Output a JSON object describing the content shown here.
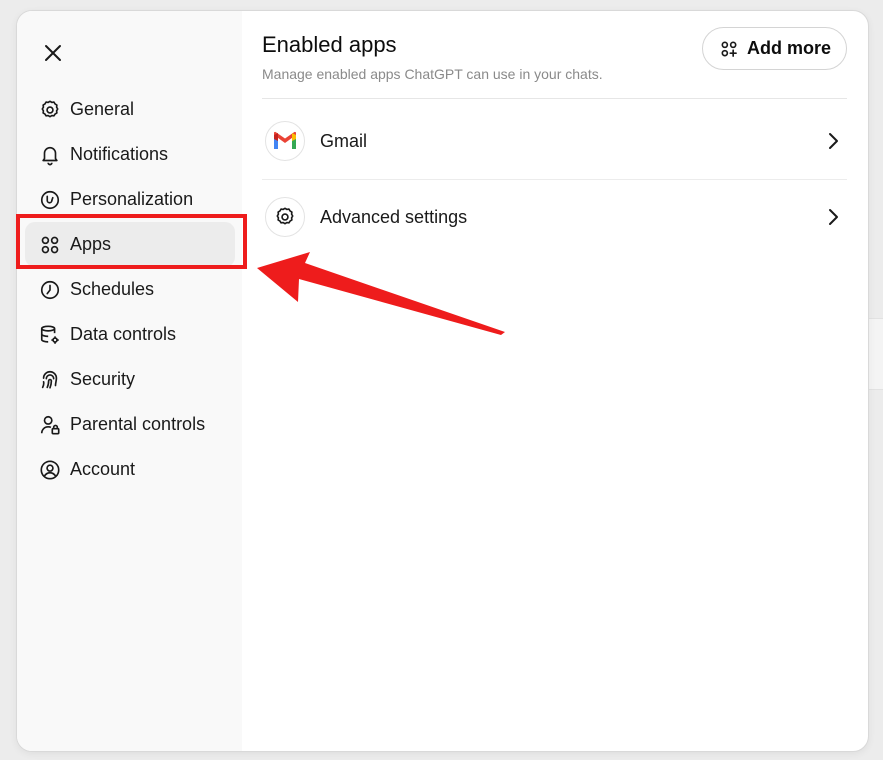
{
  "sidebar": {
    "close_label": "Close",
    "items": [
      {
        "label": "General",
        "icon": "gear-icon",
        "active": false
      },
      {
        "label": "Notifications",
        "icon": "bell-icon",
        "active": false
      },
      {
        "label": "Personalization",
        "icon": "personalization-icon",
        "active": false
      },
      {
        "label": "Apps",
        "icon": "apps-grid-icon",
        "active": true
      },
      {
        "label": "Schedules",
        "icon": "clock-icon",
        "active": false
      },
      {
        "label": "Data controls",
        "icon": "database-gear-icon",
        "active": false
      },
      {
        "label": "Security",
        "icon": "fingerprint-icon",
        "active": false
      },
      {
        "label": "Parental controls",
        "icon": "person-lock-icon",
        "active": false
      },
      {
        "label": "Account",
        "icon": "user-circle-icon",
        "active": false
      }
    ]
  },
  "main": {
    "title": "Enabled apps",
    "subtitle": "Manage enabled apps ChatGPT can use in your chats.",
    "add_more_label": "Add more",
    "rows": [
      {
        "label": "Gmail",
        "icon": "gmail-icon"
      },
      {
        "label": "Advanced settings",
        "icon": "gear-icon"
      }
    ]
  },
  "annotations": {
    "highlight_color": "#ee1c1c",
    "highlight_target": "Apps",
    "arrow_color": "#ee1c1c"
  },
  "colors": {
    "sidebar_bg": "#f9f9f9",
    "active_item_bg": "#ececec",
    "backdrop": "#ececec"
  }
}
